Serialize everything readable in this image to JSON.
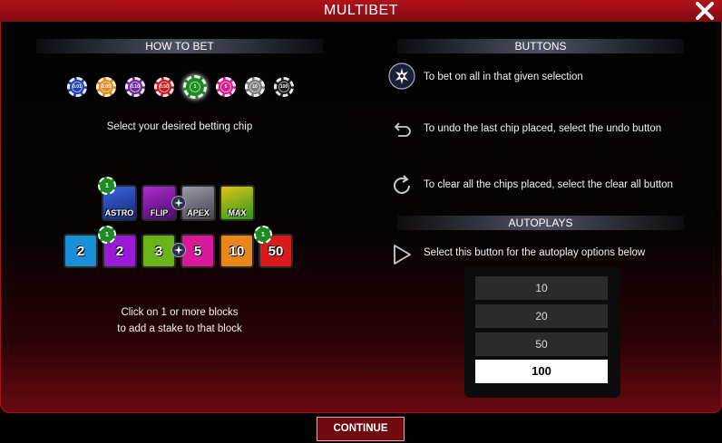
{
  "window": {
    "title": "MULTIBET"
  },
  "how_to_bet": {
    "header": "HOW TO BET",
    "chips": [
      {
        "label": "0.01",
        "color": "#1a3fb8"
      },
      {
        "label": "0.05",
        "color": "#e08a12"
      },
      {
        "label": "0.10",
        "color": "#6a2a9a"
      },
      {
        "label": "0.50",
        "color": "#c41a1a"
      },
      {
        "label": "1",
        "color": "#1e8a22"
      },
      {
        "label": "5",
        "color": "#d81a8a"
      },
      {
        "label": "10",
        "color": "#7a7a7a"
      },
      {
        "label": "100",
        "color": "#1a1a1a"
      }
    ],
    "selected_chip": "1",
    "select_text": "Select your desired betting chip",
    "symbols": [
      "ASTRO",
      "FLIP",
      "APEX",
      "MAX"
    ],
    "number_tiles": [
      {
        "label": "2",
        "color": "#1a8fd8"
      },
      {
        "label": "2",
        "color": "#9a1ad8"
      },
      {
        "label": "3",
        "color": "#6ab41a"
      },
      {
        "label": "5",
        "color": "#d81a9a"
      },
      {
        "label": "10",
        "color": "#e8861a"
      },
      {
        "label": "50",
        "color": "#d81a1a"
      }
    ],
    "placed_chip_label": "1",
    "click_text_line1": "Click on 1 or more blocks",
    "click_text_line2": "to add a stake to that block"
  },
  "buttons": {
    "header": "BUTTONS",
    "bet_all_text": "To bet on all in that given selection",
    "undo_text": "To undo the last chip placed, select the undo button",
    "clear_text": "To clear all the chips placed, select the clear all button"
  },
  "autoplays": {
    "header": "AUTOPLAYS",
    "text": "Select this button for the autoplay options below",
    "options": [
      "10",
      "20",
      "50",
      "100"
    ],
    "selected": "100"
  },
  "footer": {
    "continue_label": "CONTINUE"
  },
  "icons": {
    "close": "close-icon",
    "bet_all": "star-badge-icon",
    "undo": "undo-icon",
    "clear": "refresh-icon",
    "autoplay": "play-icon"
  },
  "colors": {
    "accent": "#b3121c",
    "panel_border": "#a8101a"
  }
}
